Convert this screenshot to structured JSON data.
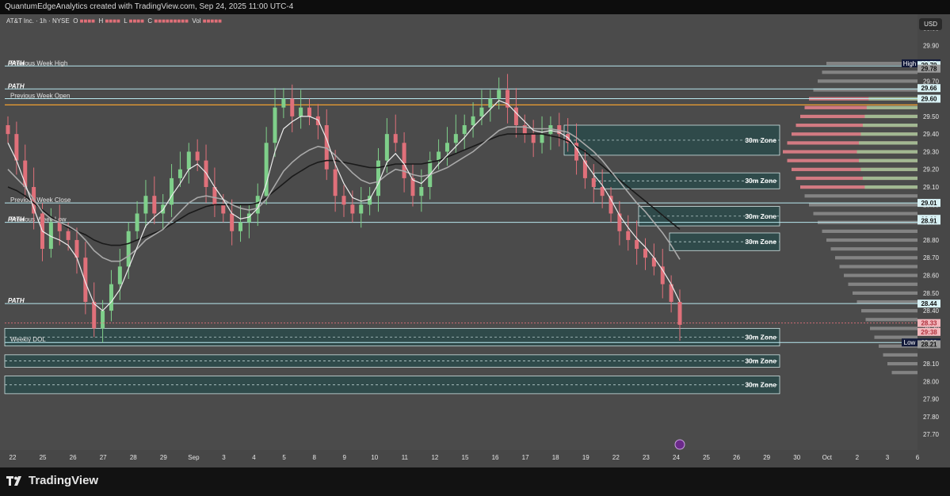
{
  "header": {
    "attribution": "QuantumEdgeAnalytics created with TradingView.com, Sep 24, 2025 11:00 UTC-4"
  },
  "legend": {
    "symbol": "AT&T Inc. · 1h · NYSE",
    "o_label": "O",
    "h_label": "H",
    "l_label": "L",
    "c_label": "C",
    "vol_label": "Vol"
  },
  "currency_button": "USD",
  "logo_text": "TradingView",
  "colors": {
    "background": "#4b4b4b",
    "up_candle": "#7fcf8a",
    "down_candle": "#e0707a",
    "level_line": "#b8e8ef",
    "open_line": "#f0a030",
    "zone_fill": "#2f4a4a",
    "zone_border": "#cfe3e3"
  },
  "chart_data": {
    "type": "candlestick",
    "y_axis": {
      "range": [
        27.62,
        30.06
      ],
      "ticks": [
        "30.00",
        "29.90",
        "29.80",
        "29.70",
        "29.60",
        "29.50",
        "29.40",
        "29.30",
        "29.20",
        "29.10",
        "29.00",
        "28.90",
        "28.80",
        "28.70",
        "28.60",
        "28.50",
        "28.40",
        "28.30",
        "28.20",
        "28.10",
        "28.00",
        "27.90",
        "27.80",
        "27.70"
      ]
    },
    "x_axis": {
      "ticks": [
        "22",
        "25",
        "26",
        "27",
        "28",
        "29",
        "Sep",
        "3",
        "4",
        "5",
        "8",
        "9",
        "10",
        "11",
        "12",
        "15",
        "16",
        "17",
        "18",
        "19",
        "22",
        "23",
        "24",
        "25",
        "26",
        "29",
        "30",
        "Oct",
        "2",
        "3",
        "6"
      ]
    },
    "close_series": [
      29.4,
      29.25,
      29.1,
      28.95,
      28.75,
      28.9,
      28.85,
      28.8,
      28.7,
      28.45,
      28.3,
      28.4,
      28.55,
      28.65,
      28.85,
      28.95,
      29.05,
      28.95,
      29.0,
      29.15,
      29.2,
      29.3,
      29.25,
      29.1,
      29.0,
      28.95,
      28.85,
      28.9,
      28.95,
      29.05,
      29.35,
      29.55,
      29.6,
      29.5,
      29.55,
      29.5,
      29.45,
      29.2,
      29.05,
      29.0,
      28.95,
      29.0,
      29.05,
      29.25,
      29.4,
      29.35,
      29.15,
      29.05,
      29.1,
      29.25,
      29.3,
      29.35,
      29.4,
      29.45,
      29.5,
      29.55,
      29.6,
      29.65,
      29.55,
      29.45,
      29.4,
      29.35,
      29.4,
      29.45,
      29.4,
      29.35,
      29.25,
      29.15,
      29.1,
      29.05,
      28.95,
      28.85,
      28.8,
      28.75,
      28.7,
      28.65,
      28.55,
      28.45,
      28.32
    ],
    "ema_fast": [
      29.35,
      29.25,
      29.12,
      28.98,
      28.85,
      28.82,
      28.8,
      28.77,
      28.7,
      28.56,
      28.44,
      28.4,
      28.45,
      28.52,
      28.64,
      28.76,
      28.88,
      28.93,
      28.97,
      29.05,
      29.12,
      29.2,
      29.23,
      29.18,
      29.1,
      29.03,
      28.95,
      28.92,
      28.93,
      28.98,
      29.12,
      29.3,
      29.43,
      29.47,
      29.5,
      29.5,
      29.48,
      29.37,
      29.23,
      29.12,
      29.04,
      29.02,
      29.03,
      29.12,
      29.24,
      29.29,
      29.23,
      29.14,
      29.12,
      29.17,
      29.23,
      29.28,
      29.33,
      29.38,
      29.44,
      29.49,
      29.54,
      29.59,
      29.57,
      29.52,
      29.47,
      29.42,
      29.41,
      29.42,
      29.41,
      29.38,
      29.32,
      29.24,
      29.17,
      29.11,
      29.03,
      28.94,
      28.87,
      28.81,
      28.76,
      28.7,
      28.63,
      28.55,
      28.45
    ],
    "ema_slow": [
      29.2,
      29.15,
      29.1,
      29.03,
      28.96,
      28.92,
      28.9,
      28.88,
      28.85,
      28.8,
      28.74,
      28.7,
      28.68,
      28.68,
      28.71,
      28.75,
      28.8,
      28.83,
      28.86,
      28.91,
      28.96,
      29.01,
      29.04,
      29.05,
      29.04,
      29.03,
      29.0,
      28.98,
      28.97,
      28.98,
      29.03,
      29.11,
      29.19,
      29.24,
      29.28,
      29.31,
      29.33,
      29.32,
      29.28,
      29.23,
      29.18,
      29.14,
      29.12,
      29.13,
      29.17,
      29.2,
      29.19,
      29.17,
      29.16,
      29.17,
      29.19,
      29.21,
      29.24,
      29.27,
      29.3,
      29.34,
      29.38,
      29.42,
      29.44,
      29.44,
      29.44,
      29.43,
      29.43,
      29.43,
      29.42,
      29.41,
      29.38,
      29.34,
      29.3,
      29.25,
      29.19,
      29.13,
      29.07,
      29.01,
      28.96,
      28.9,
      28.84,
      28.77,
      28.69
    ],
    "sma_long": [
      29.1,
      29.08,
      29.05,
      29.01,
      28.97,
      28.93,
      28.9,
      28.87,
      28.85,
      28.83,
      28.8,
      28.78,
      28.77,
      28.77,
      28.78,
      28.8,
      28.82,
      28.84,
      28.86,
      28.89,
      28.92,
      28.95,
      28.97,
      28.99,
      29.0,
      29.0,
      29.0,
      29.0,
      29.0,
      29.01,
      29.04,
      29.08,
      29.12,
      29.16,
      29.19,
      29.22,
      29.24,
      29.25,
      29.25,
      29.24,
      29.23,
      29.22,
      29.21,
      29.21,
      29.22,
      29.23,
      29.23,
      29.23,
      29.23,
      29.24,
      29.25,
      29.27,
      29.29,
      29.31,
      29.33,
      29.35,
      29.37,
      29.39,
      29.4,
      29.4,
      29.4,
      29.4,
      29.4,
      29.39,
      29.38,
      29.36,
      29.33,
      29.3,
      29.26,
      29.22,
      29.18,
      29.14,
      29.1,
      29.06,
      29.02,
      28.98,
      28.94,
      28.9,
      28.86
    ],
    "levels": [
      {
        "label": "Previous Week High",
        "tag": "PATH",
        "price": 29.785
      },
      {
        "label": "",
        "tag": "PATH",
        "price": 29.655
      },
      {
        "label": "Previous Week Open",
        "tag": "",
        "price": 29.6
      },
      {
        "label": "",
        "tag": "",
        "price": 29.565
      },
      {
        "label": "Previous Week Close",
        "tag": "",
        "price": 29.01
      },
      {
        "label": "Previous Week Low",
        "tag": "PATH",
        "price": 28.9
      },
      {
        "label": "",
        "tag": "PATH",
        "price": 28.44
      },
      {
        "label": "Weekly DOL",
        "tag": "",
        "price": 28.22
      }
    ],
    "zones": [
      {
        "label": "30m Zone",
        "top": 29.45,
        "bottom": 29.28
      },
      {
        "label": "30m Zone",
        "top": 29.18,
        "bottom": 29.09
      },
      {
        "label": "30m Zone",
        "top": 28.99,
        "bottom": 28.88
      },
      {
        "label": "30m Zone",
        "top": 28.84,
        "bottom": 28.74
      },
      {
        "label": "30m Zone",
        "top": 28.3,
        "bottom": 28.2
      },
      {
        "label": "30m Zone",
        "top": 28.15,
        "bottom": 28.08
      },
      {
        "label": "30m Zone",
        "top": 28.03,
        "bottom": 27.93
      }
    ],
    "price_tags": [
      {
        "label": "High",
        "value": "29.79",
        "style": "navy"
      },
      {
        "label": "",
        "value": "29.79",
        "style": "light"
      },
      {
        "label": "",
        "value": "29.78",
        "style": "gray"
      },
      {
        "label": "",
        "value": "29.66",
        "style": "light"
      },
      {
        "label": "",
        "value": "29.60",
        "style": "light"
      },
      {
        "label": "",
        "value": "29.01",
        "style": "light"
      },
      {
        "label": "",
        "value": "28.92",
        "style": "light"
      },
      {
        "label": "",
        "value": "28.91",
        "style": "light"
      },
      {
        "label": "",
        "value": "28.44",
        "style": "light"
      },
      {
        "label": "",
        "value": "28.33",
        "style": "red"
      },
      {
        "label": "",
        "value": "29:38",
        "style": "red"
      },
      {
        "label": "Low",
        "value": "28.22",
        "style": "navy"
      },
      {
        "label": "",
        "value": "28.21",
        "style": "gray"
      }
    ]
  }
}
